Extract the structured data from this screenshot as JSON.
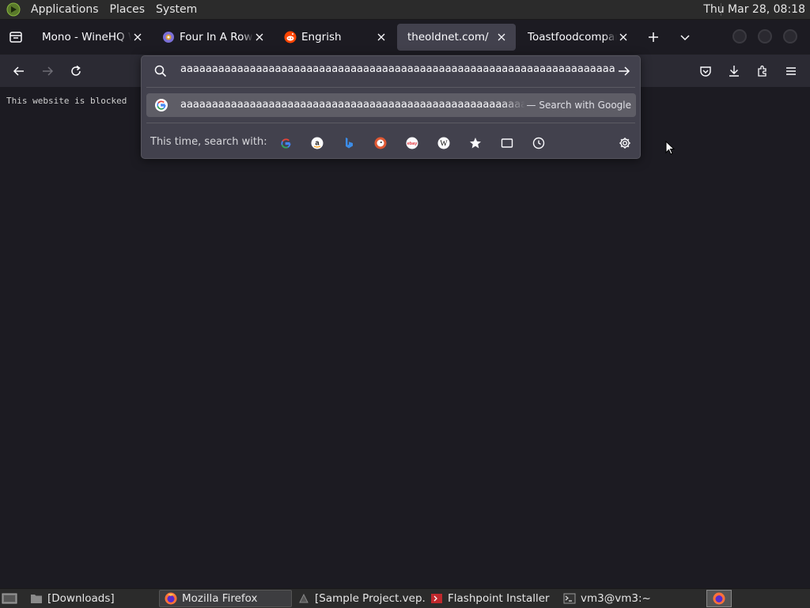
{
  "top_panel": {
    "menus": [
      "Applications",
      "Places",
      "System"
    ],
    "clock": "Thu Mar 28, 08:18"
  },
  "tabs": [
    {
      "title": "Mono - WineHQ Wiki",
      "icon": "winehq-icon",
      "active": false
    },
    {
      "title": "Four In A Row Clone",
      "icon": "gitlab-icon",
      "active": false
    },
    {
      "title": "Engrish",
      "icon": "reddit-icon",
      "active": false
    },
    {
      "title": "theoldnet.com/",
      "icon": "",
      "active": true
    },
    {
      "title": "Toastfoodcompany",
      "icon": "",
      "active": false
    }
  ],
  "page": {
    "blocked_text": "This website is blocked"
  },
  "urlbar": {
    "value": "aaaaaaaaaaaaaaaaaaaaaaaaaaaaaaaaaaaaaaaaaaaaaaaaaaaaaaaaaaaaaaaaaaaaaaaaaaaaaaaaaaaaaaaaaaaaaaaaaaaaaaaaaaaaaaa",
    "result": {
      "text": "aaaaaaaaaaaaaaaaaaaaaaaaaaaaaaaaaaaaaaaaaaaaaaaaaaaaaaaaaaaaaaaaaaaaaaaaaaaaaaaaaaaaaaaaaaaaaaaaaaaaaaaaaaaaaaaa",
      "action": "— Search with Google"
    },
    "oneoff_label": "This time, search with:",
    "engines": [
      "google",
      "amazon",
      "bing",
      "duckduckgo",
      "ebay",
      "wikipedia",
      "bookmarks",
      "tabs",
      "history"
    ]
  },
  "taskbar": {
    "items": [
      {
        "label": "[Downloads]",
        "icon": "folder-icon",
        "active": false
      },
      {
        "label": "Mozilla Firefox",
        "icon": "firefox-icon",
        "active": true
      },
      {
        "label": "[Sample Project.vep...",
        "icon": "app-icon",
        "active": false
      },
      {
        "label": "Flashpoint Installer",
        "icon": "flashpoint-icon",
        "active": false
      },
      {
        "label": "vm3@vm3:~",
        "icon": "terminal-icon",
        "active": false
      }
    ]
  },
  "colors": {
    "accent": "#00ddff",
    "toolbar": "#2b2a33",
    "tabstrip": "#1c1b22",
    "popup": "#42414d"
  }
}
